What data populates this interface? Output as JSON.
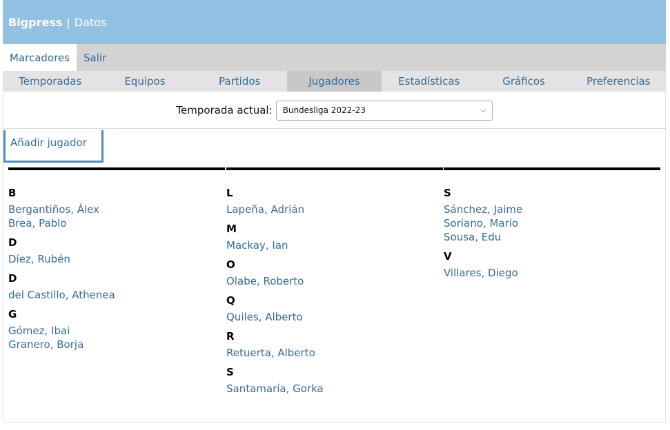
{
  "header": {
    "brand": "Bigpress",
    "separator": "|",
    "section": "Datos"
  },
  "topnav": [
    {
      "label": "Marcadores",
      "active": true
    },
    {
      "label": "Salir",
      "active": false
    }
  ],
  "subnav": [
    {
      "label": "Temporadas",
      "active": false
    },
    {
      "label": "Equipos",
      "active": false
    },
    {
      "label": "Partidos",
      "active": false
    },
    {
      "label": "Jugadores",
      "active": true
    },
    {
      "label": "Estadísticas",
      "active": false
    },
    {
      "label": "Gráficos",
      "active": false
    },
    {
      "label": "Preferencias",
      "active": false
    }
  ],
  "season": {
    "label": "Temporada actual:",
    "selected": "Bundesliga 2022-23"
  },
  "add_player_label": "Añadir jugador",
  "columns": [
    [
      {
        "letter": "B",
        "players": [
          "Bergantiños, Álex",
          "Brea, Pablo"
        ]
      },
      {
        "letter": "D",
        "players": [
          "Díez, Rubén"
        ]
      },
      {
        "letter": "D",
        "players": [
          "del Castillo, Athenea"
        ]
      },
      {
        "letter": "G",
        "players": [
          "Gómez, Ibai",
          "Granero, Borja"
        ]
      }
    ],
    [
      {
        "letter": "L",
        "players": [
          "Lapeña, Adrián"
        ]
      },
      {
        "letter": "M",
        "players": [
          "Mackay, Ian"
        ]
      },
      {
        "letter": "O",
        "players": [
          "Olabe, Roberto"
        ]
      },
      {
        "letter": "Q",
        "players": [
          "Quiles, Alberto"
        ]
      },
      {
        "letter": "R",
        "players": [
          "Retuerta, Alberto"
        ]
      },
      {
        "letter": "S",
        "players": [
          "Santamaría, Gorka"
        ]
      }
    ],
    [
      {
        "letter": "S",
        "players": [
          "Sánchez, Jaime",
          "Soriano, Mario",
          "Sousa, Edu"
        ]
      },
      {
        "letter": "V",
        "players": [
          "Villares, Diego"
        ]
      }
    ]
  ]
}
